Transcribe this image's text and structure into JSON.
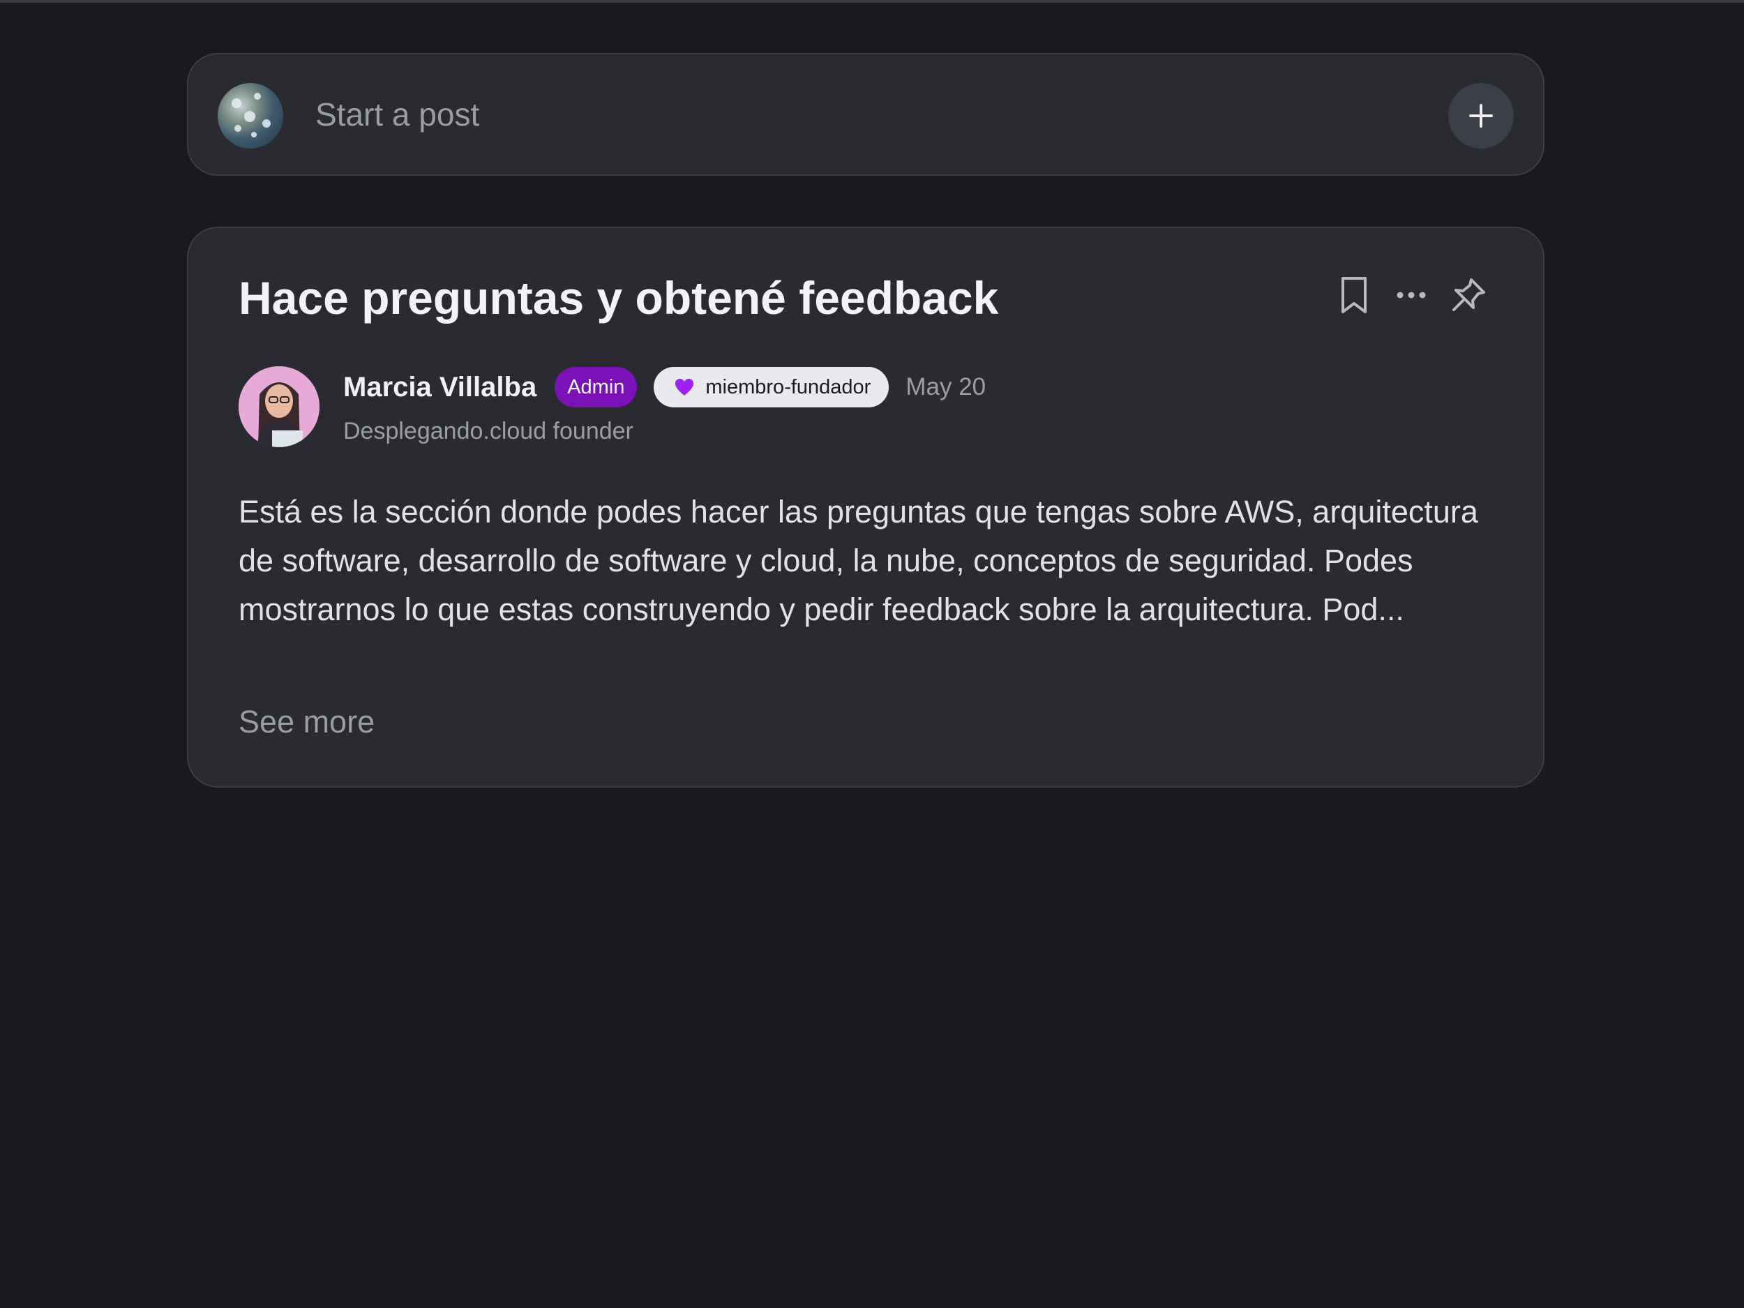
{
  "composer": {
    "placeholder": "Start a post",
    "add_icon": "plus-icon"
  },
  "post": {
    "title": "Hace preguntas y obtené feedback",
    "actions": {
      "bookmark_icon": "bookmark-icon",
      "more_icon": "more-horizontal-icon",
      "pin_icon": "pin-icon"
    },
    "author": {
      "name": "Marcia Villalba",
      "role_badge": "Admin",
      "member_badge": "miembro-fundador",
      "member_badge_icon": "heart-icon",
      "date": "May 20",
      "headline": "Desplegando.cloud founder"
    },
    "body": "Está es la sección donde podes hacer las preguntas que tengas sobre AWS, arquitectura de software, desarrollo de software y cloud, la nube, conceptos de seguridad. Podes mostrarnos lo que estas construyendo y pedir feedback sobre la arquitectura. Pod...",
    "see_more": "See more"
  },
  "colors": {
    "background": "#181a1f",
    "card": "#2a2b30",
    "admin_badge": "#7a12b8",
    "heart": "#a020f0"
  }
}
